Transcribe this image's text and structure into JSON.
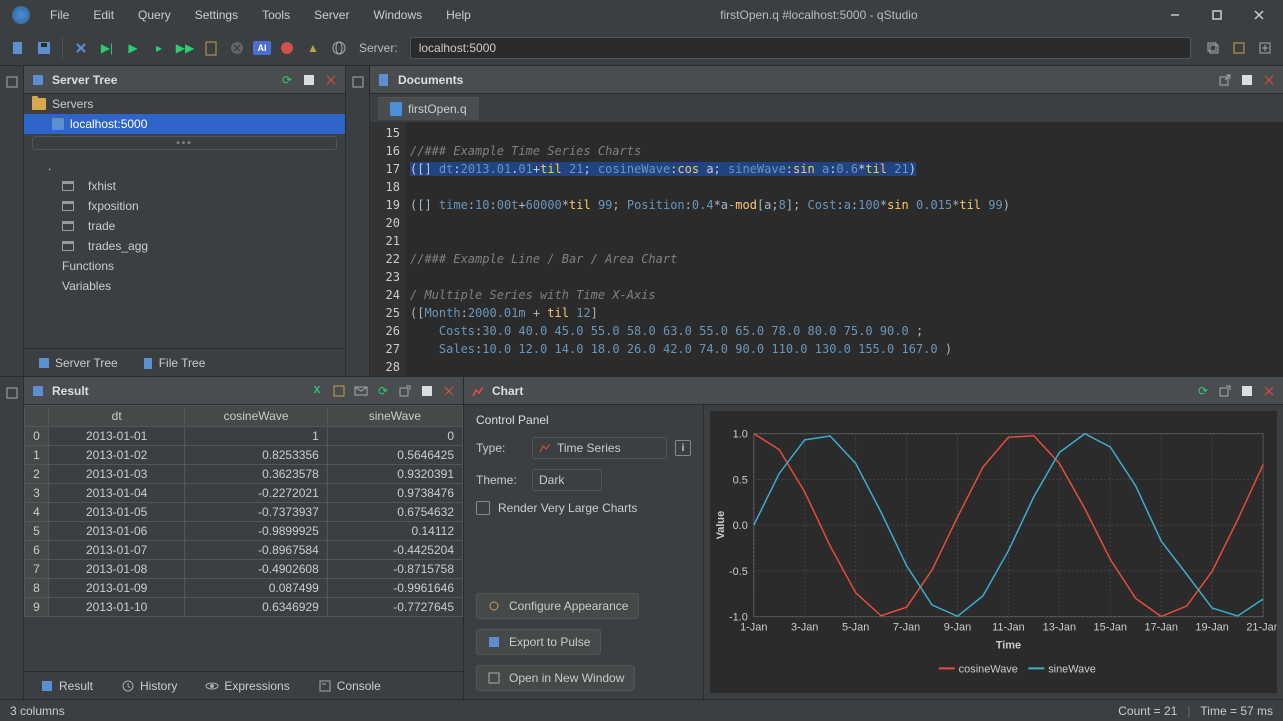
{
  "titlebar": {
    "title": "firstOpen.q #localhost:5000 - qStudio",
    "menu": [
      "File",
      "Edit",
      "Query",
      "Settings",
      "Tools",
      "Server",
      "Windows",
      "Help"
    ]
  },
  "toolbar": {
    "server_label": "Server:",
    "server_value": "localhost:5000"
  },
  "serverTree": {
    "title": "Server Tree",
    "root": "Servers",
    "server": "localhost:5000",
    "namespaces_root": ".",
    "items": [
      "fxhist",
      "fxposition",
      "trade",
      "trades_agg",
      "Functions",
      "Variables"
    ],
    "tabs": {
      "tree": "Server Tree",
      "file": "File Tree"
    }
  },
  "documents": {
    "title": "Documents",
    "tab": "firstOpen.q"
  },
  "editor": {
    "lines_start": 15,
    "lines": [
      "",
      "//### Example Time Series Charts",
      "([] dt:2013.01.01+til 21; cosineWave:cos a; sineWave:sin a:0.6*til 21)",
      "",
      "([] time:10:00t+60000*til 99; Position:0.4*a-mod[a;8]; Cost:a:100*sin 0.015*til 99)",
      "",
      "",
      "//### Example Line / Bar / Area Chart",
      "",
      "/ Multiple Series with Time X-Axis",
      "([Month:2000.01m + til 12]",
      "    Costs:30.0 40.0 45.0 55.0 58.0 63.0 55.0 65.0 78.0 80.0 75.0 90.0 ;",
      "    Sales:10.0 12.0 14.0 18.0 26.0 42.0 74.0 90.0 110.0 130.0 155.0 167.0 )",
      ""
    ]
  },
  "result": {
    "title": "Result",
    "headers": [
      "dt",
      "cosineWave",
      "sineWave"
    ],
    "rows": [
      [
        "0",
        "2013-01-01",
        "1",
        "0"
      ],
      [
        "1",
        "2013-01-02",
        "0.8253356",
        "0.5646425"
      ],
      [
        "2",
        "2013-01-03",
        "0.3623578",
        "0.9320391"
      ],
      [
        "3",
        "2013-01-04",
        "-0.2272021",
        "0.9738476"
      ],
      [
        "4",
        "2013-01-05",
        "-0.7373937",
        "0.6754632"
      ],
      [
        "5",
        "2013-01-06",
        "-0.9899925",
        "0.14112"
      ],
      [
        "6",
        "2013-01-07",
        "-0.8967584",
        "-0.4425204"
      ],
      [
        "7",
        "2013-01-08",
        "-0.4902608",
        "-0.8715758"
      ],
      [
        "8",
        "2013-01-09",
        "0.087499",
        "-0.9961646"
      ],
      [
        "9",
        "2013-01-10",
        "0.6346929",
        "-0.7727645"
      ]
    ],
    "tabs": [
      "Result",
      "History",
      "Expressions",
      "Console"
    ]
  },
  "chart": {
    "title": "Chart",
    "panel_title": "Control Panel",
    "type_label": "Type:",
    "type_value": "Time Series",
    "theme_label": "Theme:",
    "theme_value": "Dark",
    "render_large": "Render Very Large Charts",
    "btn_configure": "Configure Appearance",
    "btn_export": "Export to Pulse",
    "btn_window": "Open in New Window",
    "xlabel": "Time",
    "ylabel": "Value",
    "legend": [
      "cosineWave",
      "sineWave"
    ]
  },
  "statusbar": {
    "cols": "3 columns",
    "count": "Count = 21",
    "time": "Time = 57 ms"
  },
  "chart_data": {
    "type": "line",
    "title": "",
    "xlabel": "Time",
    "ylabel": "Value",
    "ylim": [
      -1.0,
      1.0
    ],
    "xticks": [
      "1-Jan",
      "3-Jan",
      "5-Jan",
      "7-Jan",
      "9-Jan",
      "11-Jan",
      "13-Jan",
      "15-Jan",
      "17-Jan",
      "19-Jan",
      "21-Jan"
    ],
    "yticks": [
      -1.0,
      -0.5,
      0.0,
      0.5,
      1.0
    ],
    "categories": [
      "1-Jan",
      "2-Jan",
      "3-Jan",
      "4-Jan",
      "5-Jan",
      "6-Jan",
      "7-Jan",
      "8-Jan",
      "9-Jan",
      "10-Jan",
      "11-Jan",
      "12-Jan",
      "13-Jan",
      "14-Jan",
      "15-Jan",
      "16-Jan",
      "17-Jan",
      "18-Jan",
      "19-Jan",
      "20-Jan",
      "21-Jan"
    ],
    "series": [
      {
        "name": "cosineWave",
        "color": "#e74c3c",
        "values": [
          1.0,
          0.8253,
          0.3624,
          -0.2272,
          -0.7374,
          -0.99,
          -0.8968,
          -0.4903,
          0.0875,
          0.6347,
          0.9602,
          0.9766,
          0.6755,
          0.1806,
          -0.3739,
          -0.8011,
          -0.9983,
          -0.8839,
          -0.5048,
          0.0575,
          0.6603
        ]
      },
      {
        "name": "sineWave",
        "color": "#3baecc",
        "values": [
          0.0,
          0.5646,
          0.932,
          0.9738,
          0.6755,
          0.1411,
          -0.4425,
          -0.8716,
          -0.9962,
          -0.7728,
          -0.2794,
          0.3115,
          0.7937,
          0.9985,
          0.8546,
          0.4274,
          -0.1743,
          -0.5367,
          -0.9056,
          -0.9927,
          -0.809
        ]
      }
    ]
  }
}
